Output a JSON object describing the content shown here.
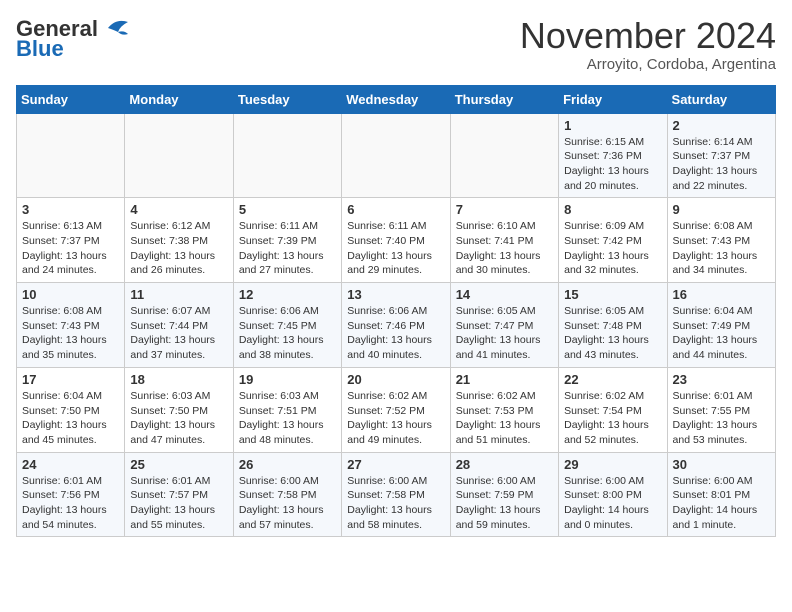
{
  "header": {
    "logo_line1": "General",
    "logo_line2": "Blue",
    "month": "November 2024",
    "location": "Arroyito, Cordoba, Argentina"
  },
  "weekdays": [
    "Sunday",
    "Monday",
    "Tuesday",
    "Wednesday",
    "Thursday",
    "Friday",
    "Saturday"
  ],
  "weeks": [
    [
      {
        "day": "",
        "info": ""
      },
      {
        "day": "",
        "info": ""
      },
      {
        "day": "",
        "info": ""
      },
      {
        "day": "",
        "info": ""
      },
      {
        "day": "",
        "info": ""
      },
      {
        "day": "1",
        "info": "Sunrise: 6:15 AM\nSunset: 7:36 PM\nDaylight: 13 hours\nand 20 minutes."
      },
      {
        "day": "2",
        "info": "Sunrise: 6:14 AM\nSunset: 7:37 PM\nDaylight: 13 hours\nand 22 minutes."
      }
    ],
    [
      {
        "day": "3",
        "info": "Sunrise: 6:13 AM\nSunset: 7:37 PM\nDaylight: 13 hours\nand 24 minutes."
      },
      {
        "day": "4",
        "info": "Sunrise: 6:12 AM\nSunset: 7:38 PM\nDaylight: 13 hours\nand 26 minutes."
      },
      {
        "day": "5",
        "info": "Sunrise: 6:11 AM\nSunset: 7:39 PM\nDaylight: 13 hours\nand 27 minutes."
      },
      {
        "day": "6",
        "info": "Sunrise: 6:11 AM\nSunset: 7:40 PM\nDaylight: 13 hours\nand 29 minutes."
      },
      {
        "day": "7",
        "info": "Sunrise: 6:10 AM\nSunset: 7:41 PM\nDaylight: 13 hours\nand 30 minutes."
      },
      {
        "day": "8",
        "info": "Sunrise: 6:09 AM\nSunset: 7:42 PM\nDaylight: 13 hours\nand 32 minutes."
      },
      {
        "day": "9",
        "info": "Sunrise: 6:08 AM\nSunset: 7:43 PM\nDaylight: 13 hours\nand 34 minutes."
      }
    ],
    [
      {
        "day": "10",
        "info": "Sunrise: 6:08 AM\nSunset: 7:43 PM\nDaylight: 13 hours\nand 35 minutes."
      },
      {
        "day": "11",
        "info": "Sunrise: 6:07 AM\nSunset: 7:44 PM\nDaylight: 13 hours\nand 37 minutes."
      },
      {
        "day": "12",
        "info": "Sunrise: 6:06 AM\nSunset: 7:45 PM\nDaylight: 13 hours\nand 38 minutes."
      },
      {
        "day": "13",
        "info": "Sunrise: 6:06 AM\nSunset: 7:46 PM\nDaylight: 13 hours\nand 40 minutes."
      },
      {
        "day": "14",
        "info": "Sunrise: 6:05 AM\nSunset: 7:47 PM\nDaylight: 13 hours\nand 41 minutes."
      },
      {
        "day": "15",
        "info": "Sunrise: 6:05 AM\nSunset: 7:48 PM\nDaylight: 13 hours\nand 43 minutes."
      },
      {
        "day": "16",
        "info": "Sunrise: 6:04 AM\nSunset: 7:49 PM\nDaylight: 13 hours\nand 44 minutes."
      }
    ],
    [
      {
        "day": "17",
        "info": "Sunrise: 6:04 AM\nSunset: 7:50 PM\nDaylight: 13 hours\nand 45 minutes."
      },
      {
        "day": "18",
        "info": "Sunrise: 6:03 AM\nSunset: 7:50 PM\nDaylight: 13 hours\nand 47 minutes."
      },
      {
        "day": "19",
        "info": "Sunrise: 6:03 AM\nSunset: 7:51 PM\nDaylight: 13 hours\nand 48 minutes."
      },
      {
        "day": "20",
        "info": "Sunrise: 6:02 AM\nSunset: 7:52 PM\nDaylight: 13 hours\nand 49 minutes."
      },
      {
        "day": "21",
        "info": "Sunrise: 6:02 AM\nSunset: 7:53 PM\nDaylight: 13 hours\nand 51 minutes."
      },
      {
        "day": "22",
        "info": "Sunrise: 6:02 AM\nSunset: 7:54 PM\nDaylight: 13 hours\nand 52 minutes."
      },
      {
        "day": "23",
        "info": "Sunrise: 6:01 AM\nSunset: 7:55 PM\nDaylight: 13 hours\nand 53 minutes."
      }
    ],
    [
      {
        "day": "24",
        "info": "Sunrise: 6:01 AM\nSunset: 7:56 PM\nDaylight: 13 hours\nand 54 minutes."
      },
      {
        "day": "25",
        "info": "Sunrise: 6:01 AM\nSunset: 7:57 PM\nDaylight: 13 hours\nand 55 minutes."
      },
      {
        "day": "26",
        "info": "Sunrise: 6:00 AM\nSunset: 7:58 PM\nDaylight: 13 hours\nand 57 minutes."
      },
      {
        "day": "27",
        "info": "Sunrise: 6:00 AM\nSunset: 7:58 PM\nDaylight: 13 hours\nand 58 minutes."
      },
      {
        "day": "28",
        "info": "Sunrise: 6:00 AM\nSunset: 7:59 PM\nDaylight: 13 hours\nand 59 minutes."
      },
      {
        "day": "29",
        "info": "Sunrise: 6:00 AM\nSunset: 8:00 PM\nDaylight: 14 hours\nand 0 minutes."
      },
      {
        "day": "30",
        "info": "Sunrise: 6:00 AM\nSunset: 8:01 PM\nDaylight: 14 hours\nand 1 minute."
      }
    ]
  ]
}
